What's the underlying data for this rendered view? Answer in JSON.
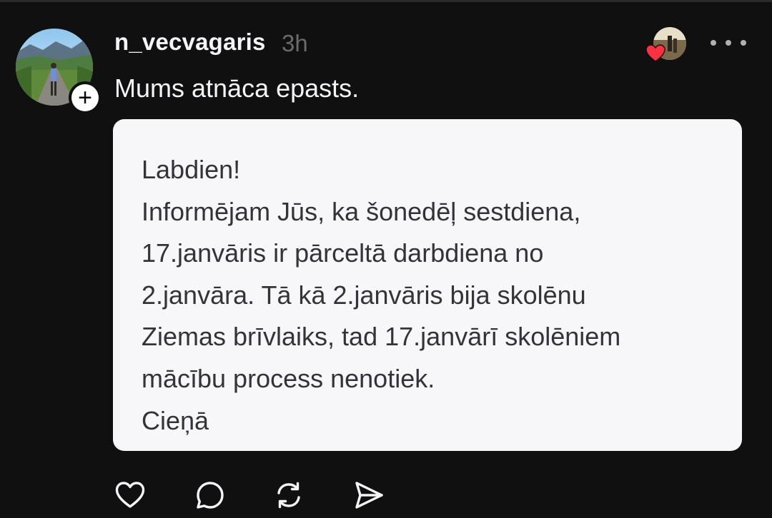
{
  "post": {
    "username": "n_vecvagaris",
    "timestamp": "3h",
    "caption": "Mums atnāca epasts.",
    "follow_symbol": "+"
  },
  "email": {
    "lines": [
      "Labdien!",
      "Informējam Jūs, ka šonedēļ sestdiena,",
      "17.janvāris ir pārceltā darbdiena no",
      "2.janvāra. Tā kā 2.janvāris bija skolēnu",
      "Ziemas brīvlaiks, tad 17.janvārī skolēniem",
      "mācību process nenotiek.",
      "Cieņā"
    ]
  },
  "icons": {
    "like": "heart-outline-icon",
    "reply": "comment-bubble-icon",
    "repost": "repost-icon",
    "share": "send-icon",
    "more": "more-horizontal-icon",
    "liked_badge": "heart-filled-icon"
  },
  "colors": {
    "background": "#101010",
    "text_primary": "#f3f5f7",
    "text_secondary": "#6b6b6b",
    "card_background": "#f7f7fa",
    "card_text": "#33343a",
    "heart_red": "#ff3040"
  }
}
